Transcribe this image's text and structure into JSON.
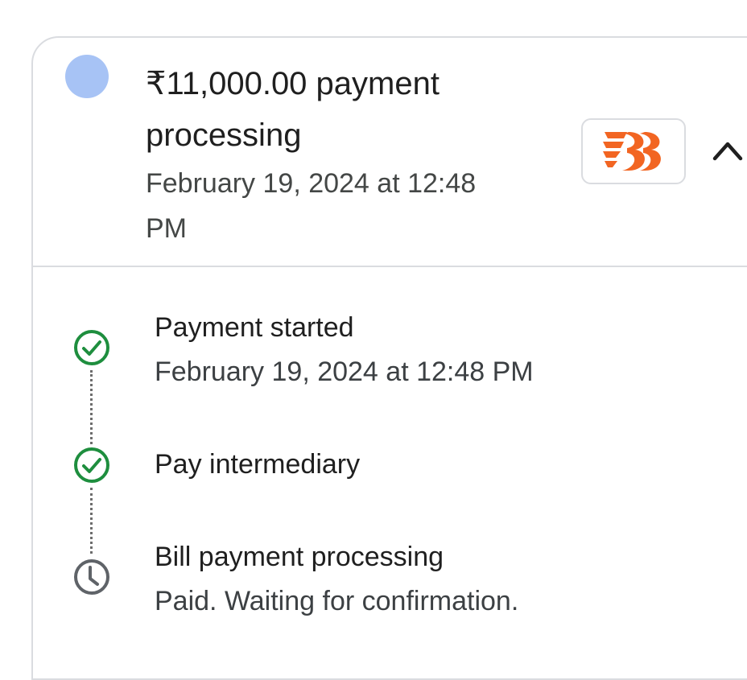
{
  "payment": {
    "title": "₹11,000.00 payment processing",
    "date_line": "February 19, 2024 at 12:48 PM",
    "status_color": "#a7c3f5",
    "bank_logo": "bank-of-baroda-logo",
    "expand_icon": "chevron-up-icon"
  },
  "timeline": {
    "steps": [
      {
        "title": "Payment started",
        "subtitle": "February 19, 2024 at 12:48 PM",
        "icon": "check-circle-icon",
        "state": "done",
        "color": "#1e8e3e"
      },
      {
        "title": "Pay intermediary",
        "subtitle": "",
        "icon": "check-circle-icon",
        "state": "done",
        "color": "#1e8e3e"
      },
      {
        "title": "Bill payment processing",
        "subtitle": "Paid. Waiting for confirmation.",
        "icon": "clock-icon",
        "state": "pending",
        "color": "#5f6368"
      }
    ]
  }
}
